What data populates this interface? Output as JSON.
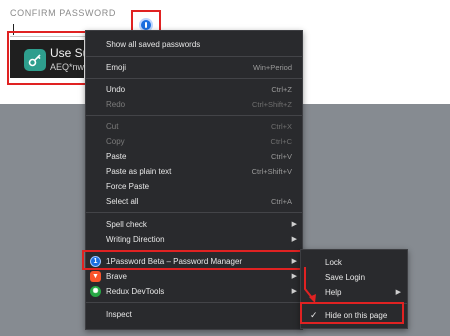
{
  "form": {
    "field_label": "CONFIRM PASSWORD"
  },
  "suggestion": {
    "title": "Use Su",
    "subtitle": "AEQ*nw"
  },
  "context_menu": {
    "items": {
      "show_saved": "Show all saved passwords",
      "emoji": {
        "label": "Emoji",
        "shortcut": "Win+Period"
      },
      "undo": {
        "label": "Undo",
        "shortcut": "Ctrl+Z"
      },
      "redo": {
        "label": "Redo",
        "shortcut": "Ctrl+Shift+Z"
      },
      "cut": {
        "label": "Cut",
        "shortcut": "Ctrl+X"
      },
      "copy": {
        "label": "Copy",
        "shortcut": "Ctrl+C"
      },
      "paste": {
        "label": "Paste",
        "shortcut": "Ctrl+V"
      },
      "paste_plain": {
        "label": "Paste as plain text",
        "shortcut": "Ctrl+Shift+V"
      },
      "force_paste": "Force Paste",
      "select_all": {
        "label": "Select all",
        "shortcut": "Ctrl+A"
      },
      "spell_check": "Spell check",
      "writing_direction": "Writing Direction",
      "onepassword": "1Password Beta – Password Manager",
      "brave": "Brave",
      "redux": "Redux DevTools",
      "inspect": "Inspect"
    }
  },
  "submenu": {
    "lock": "Lock",
    "save_login": "Save Login",
    "help": "Help",
    "hide_on_page": "Hide on this page"
  },
  "icons": {
    "password_field": "1password-icon",
    "suggestion": "key-icon",
    "onepassword": "1password-icon",
    "brave": "brave-lion-icon",
    "redux": "redux-icon",
    "submenu_arrow": "chevron-right-icon",
    "check": "checkmark-icon"
  },
  "colors": {
    "highlight": "#e02222",
    "menu_bg": "#292a2d",
    "onepassword_blue": "#1a6ee0",
    "brave_orange": "#fb542b",
    "redux_green": "#27a844",
    "key_teal": "#2e9e8d"
  }
}
